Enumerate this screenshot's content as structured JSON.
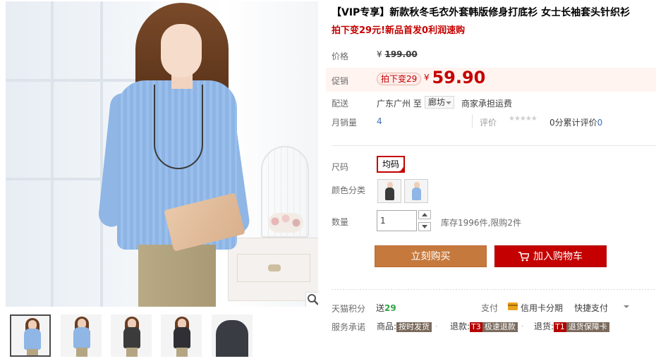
{
  "product": {
    "title": "【VIP专享】新款秋冬毛衣外套韩版修身打底衫 女士长袖套头针织衫",
    "subtitle": "拍下变29元!新品首发0利润速购"
  },
  "price": {
    "label": "价格",
    "currency": "¥",
    "original": "199.00"
  },
  "promo": {
    "label": "促销",
    "tag": "拍下变29",
    "currency": "¥",
    "price": "59.90"
  },
  "shipping": {
    "label": "配送",
    "from": "广东广州",
    "to_word": "至",
    "destination": "廊坊",
    "fee_note": "商家承担运费"
  },
  "sales": {
    "label": "月销量",
    "count": "4",
    "rating_label": "评价",
    "stars": "★★★★★",
    "score": "0分",
    "total_label": "累计评价",
    "total": "0"
  },
  "size": {
    "label": "尺码",
    "option": "均码"
  },
  "color": {
    "label": "颜色分类",
    "swatches": [
      {
        "name": "黑色",
        "color": "#3a3a3a"
      },
      {
        "name": "蓝色",
        "color": "#8fb6e5"
      }
    ]
  },
  "quantity": {
    "label": "数量",
    "value": "1",
    "stock": "库存1996件,限购2件"
  },
  "actions": {
    "buy_now": "立刻购买",
    "add_to_cart": "加入购物车"
  },
  "points": {
    "label": "天猫积分",
    "prefix": "送",
    "value": "29"
  },
  "payment": {
    "label": "支付",
    "credit": "信用卡分期",
    "fast": "快捷支付"
  },
  "service": {
    "label": "服务承诺",
    "items": [
      {
        "prefix": "商品:",
        "badge": "",
        "tag": "按时发货"
      },
      {
        "prefix": "退款:",
        "badge": "T3",
        "tag": "极速退款"
      },
      {
        "prefix": "退货:",
        "badge": "T1",
        "tag": "退货保障卡"
      }
    ]
  },
  "gallery": {
    "thumbnails": [
      {
        "sweater": "#8fb6e5"
      },
      {
        "sweater": "#8fb6e5"
      },
      {
        "sweater": "#3b3b3b"
      },
      {
        "sweater": "#2f2f35"
      },
      {
        "sweater": "#3a3c44"
      }
    ]
  },
  "colors": {
    "accent_red": "#c40000",
    "buy_orange": "#c6793d",
    "link_blue": "#3d6fb6",
    "points_green": "#33a245"
  }
}
